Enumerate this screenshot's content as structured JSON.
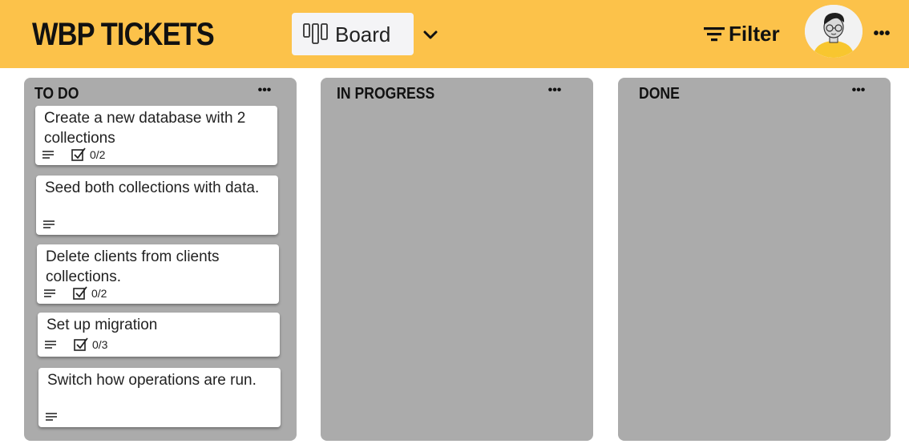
{
  "header": {
    "title": "WBP TICKETS",
    "view_label": "Board",
    "filter_label": "Filter",
    "accent": "#fcc24a"
  },
  "columns": [
    {
      "title": "TO DO",
      "cards": [
        {
          "title": "Create a new database with 2 collections",
          "has_description": true,
          "checklist": "0/2"
        },
        {
          "title": "Seed both collections with data.",
          "has_description": true,
          "checklist": ""
        },
        {
          "title": "Delete clients from clients collections.",
          "has_description": true,
          "checklist": "0/2"
        },
        {
          "title": "Set up migration",
          "has_description": true,
          "checklist": "0/3"
        },
        {
          "title": "Switch how operations are run.",
          "has_description": true,
          "checklist": ""
        }
      ]
    },
    {
      "title": "IN PROGRESS",
      "cards": []
    },
    {
      "title": "DONE",
      "cards": []
    }
  ],
  "icons": {
    "board": "board-view-icon",
    "chevron": "chevron-down-icon",
    "filter": "filter-icon",
    "more": "more-options-icon",
    "description": "description-icon",
    "checklist": "checklist-icon"
  },
  "colors": {
    "column_bg": "#ababab",
    "card_bg": "#ffffff",
    "view_select_bg": "#f4f4f6"
  }
}
